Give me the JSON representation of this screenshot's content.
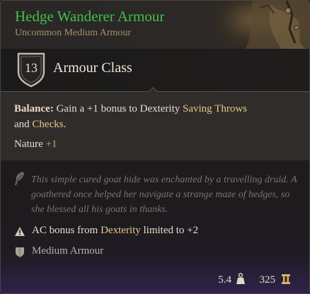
{
  "item": {
    "name": "Hedge Wanderer Armour",
    "rarity_type": "Uncommon Medium Armour",
    "rarity_color": "#3fbf4f"
  },
  "armour_class": {
    "value": "13",
    "label": "Armour Class",
    "icon": "shield-icon"
  },
  "properties": {
    "balance_label": "Balance:",
    "balance_pre": "Gain a +1 bonus to Dexterity",
    "balance_hl1": "Saving Throws",
    "balance_mid": "and",
    "balance_hl2": "Checks",
    "balance_end": ".",
    "nature_label": "Nature",
    "nature_bonus": "+1"
  },
  "lore": {
    "icon": "quill-icon",
    "text": "This simple cured goat hide was enchanted by a travelling druid. A goathered once helped her navigate a strange maze of hedges, so she blessed all his goats in thanks."
  },
  "restrictions": {
    "icon": "warning-icon",
    "pre": "AC bonus from",
    "stat": "Dexterity",
    "post": "limited to +2"
  },
  "armour_type": {
    "icon": "armour-type-icon",
    "label": "Medium Armour"
  },
  "footer": {
    "weight": "5.4",
    "weight_icon": "weight-icon",
    "price": "325",
    "price_icon": "gold-icon"
  },
  "colors": {
    "highlight": "#e6c98a",
    "text": "#e6ddcd",
    "subtitle": "#a48e6c"
  }
}
